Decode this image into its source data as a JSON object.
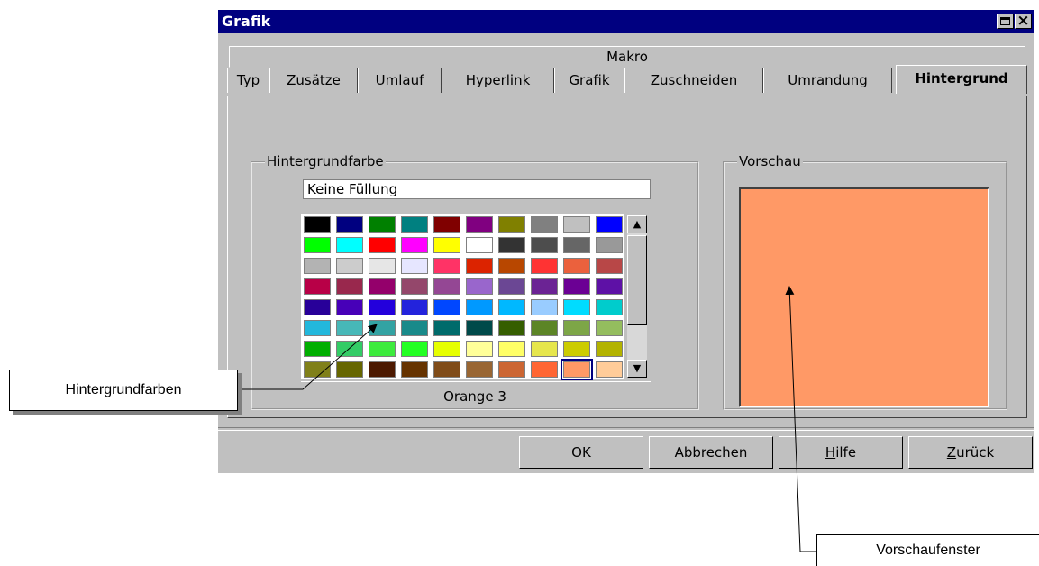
{
  "window": {
    "title": "Grafik"
  },
  "tabs": {
    "row1": [
      "Makro"
    ],
    "row2": [
      "Typ",
      "Zusätze",
      "Umlauf",
      "Hyperlink",
      "Grafik",
      "Zuschneiden",
      "Umrandung",
      "Hintergrund"
    ],
    "active": "Hintergrund"
  },
  "background_color_group": {
    "title": "Hintergrundfarbe",
    "no_fill_label": "Keine Füllung",
    "selected_color_name": "Orange 3",
    "palette": [
      [
        "#000000",
        "#000080",
        "#008000",
        "#008080",
        "#800000",
        "#800080",
        "#808000",
        "#808080",
        "#c0c0c0",
        "#0000ff"
      ],
      [
        "#00ff00",
        "#00ffff",
        "#ff0000",
        "#ff00ff",
        "#ffff00",
        "#ffffff",
        "#333333",
        "#4d4d4d",
        "#666666",
        "#999999"
      ],
      [
        "#b3b3b3",
        "#cccccc",
        "#e6e6e6",
        "#e6e6ff",
        "#ff3366",
        "#dc2300",
        "#b84700",
        "#ff3333",
        "#eb613d",
        "#b84747"
      ],
      [
        "#b80047",
        "#99284d",
        "#94006b",
        "#94476b",
        "#944794",
        "#9966cc",
        "#6b4794",
        "#6b2394",
        "#6b0094",
        "#5e11a6"
      ],
      [
        "#280099",
        "#4700b8",
        "#2300dc",
        "#2323dc",
        "#0047ff",
        "#0099ff",
        "#00b8ff",
        "#99ccff",
        "#00dcff",
        "#00cccc"
      ],
      [
        "#23b8dc",
        "#47b8b8",
        "#33a3a3",
        "#198a8a",
        "#006b6b",
        "#004a4a",
        "#355e00",
        "#5c8526",
        "#7da647",
        "#94bd5e"
      ],
      [
        "#00ae00",
        "#33cc66",
        "#3deb3d",
        "#23ff23",
        "#e6ff00",
        "#ffff99",
        "#ffff66",
        "#e6e64c",
        "#cccc00",
        "#b3b300"
      ],
      [
        "#808019",
        "#666600",
        "#4c1900",
        "#663300",
        "#804c19",
        "#996633",
        "#cc6633",
        "#ff6633",
        "#ff9966",
        "#ffcc99"
      ]
    ],
    "selected_index": [
      7,
      8
    ]
  },
  "preview_group": {
    "title": "Vorschau",
    "color": "#ff9966"
  },
  "buttons": {
    "ok": "OK",
    "cancel": "Abbrechen",
    "help_first": "H",
    "help_rest": "ilfe",
    "reset_first": "Z",
    "reset_rest": "urück"
  },
  "annotations": {
    "palette_callout": "Hintergrundfarben",
    "preview_callout": "Vorschaufenster"
  }
}
